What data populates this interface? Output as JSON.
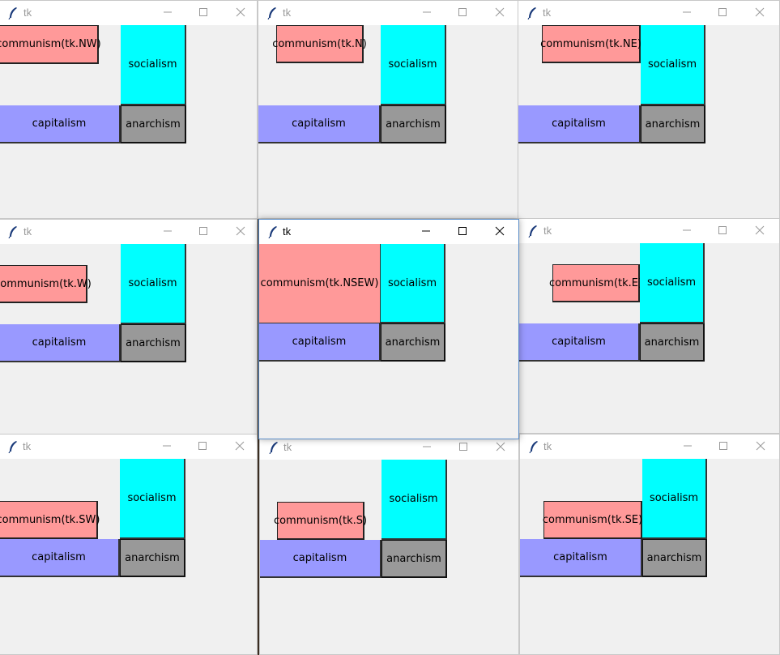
{
  "colors": {
    "communism": "#ff9999",
    "socialism": "#00ffff",
    "capitalism": "#9999ff",
    "anarchism": "#999999"
  },
  "widgets": {
    "socialism": "socialism",
    "capitalism": "capitalism",
    "anarchism": "anarchism"
  },
  "windows": [
    {
      "id": "nw",
      "title": "tk",
      "communism_label": "communism(tk.NW)"
    },
    {
      "id": "n",
      "title": "tk",
      "communism_label": "communism(tk.N)"
    },
    {
      "id": "ne",
      "title": "tk",
      "communism_label": "communism(tk.NE)"
    },
    {
      "id": "w",
      "title": "tk",
      "communism_label": "communism(tk.W)"
    },
    {
      "id": "nsew",
      "title": "tk",
      "communism_label": "communism(tk.NSEW)",
      "active": true
    },
    {
      "id": "e",
      "title": "tk",
      "communism_label": "communism(tk.E)"
    },
    {
      "id": "sw",
      "title": "tk",
      "communism_label": "communism(tk.SW)"
    },
    {
      "id": "s",
      "title": "tk",
      "communism_label": "communism(tk.S)"
    },
    {
      "id": "se",
      "title": "tk",
      "communism_label": "communism(tk.SE)"
    }
  ]
}
